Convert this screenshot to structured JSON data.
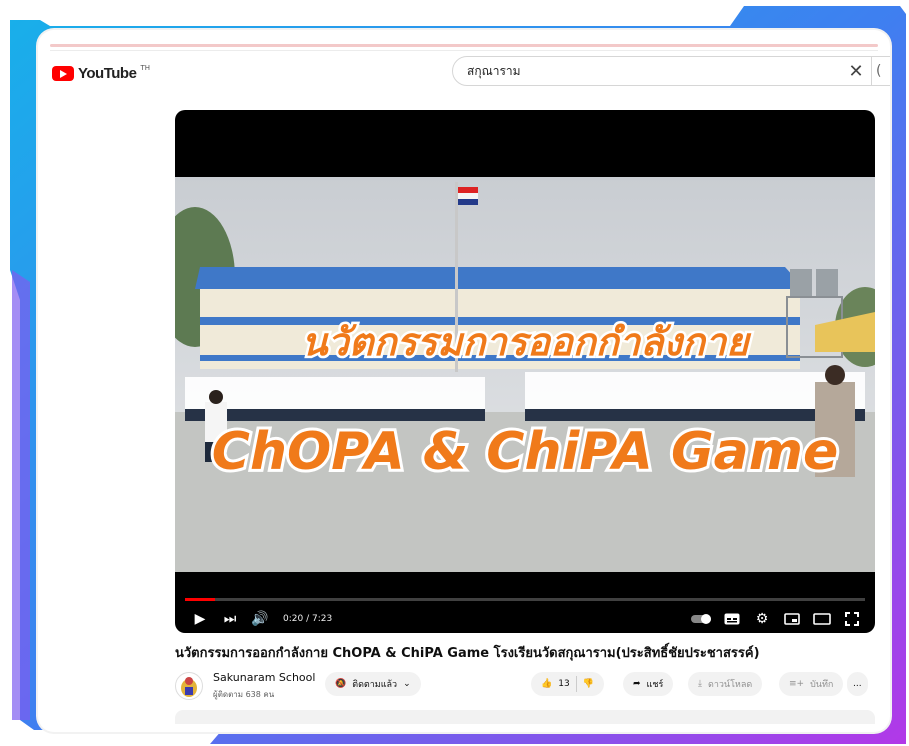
{
  "youtube": {
    "logo_text": "YouTube",
    "logo_tm": "TH"
  },
  "search": {
    "value": "สกุณาราม",
    "clear_icon": "close-icon",
    "search_icon": "search-icon"
  },
  "player": {
    "progress_fraction": 0.044,
    "time_display": "0:20 / 7:23",
    "overlay_line1": "นวัตกรรมการออกกำลังกาย",
    "overlay_line2": "ChOPA & ChiPA Game"
  },
  "video": {
    "title": "นวัตกรรมการออกกำลังกาย ChOPA & ChiPA Game โรงเรียนวัดสกุณาราม(ประสิทธิ์ชัยประชาสรรค์)"
  },
  "channel": {
    "name": "Sakunaram School",
    "subscribers": "ผู้ติดตาม 638 คน",
    "subscribe_label": "ติดตามแล้ว"
  },
  "actions": {
    "like_count": "13",
    "share_label": "แชร์",
    "download_label": "ดาวน์โหลด",
    "save_label": "บันทึก",
    "more_label": "..."
  },
  "colors": {
    "brand_red": "#ff0000",
    "frame_blue": "#1fa0e6",
    "frame_purple": "#a33be8",
    "overlay_text_orange": "#f07a1a"
  }
}
